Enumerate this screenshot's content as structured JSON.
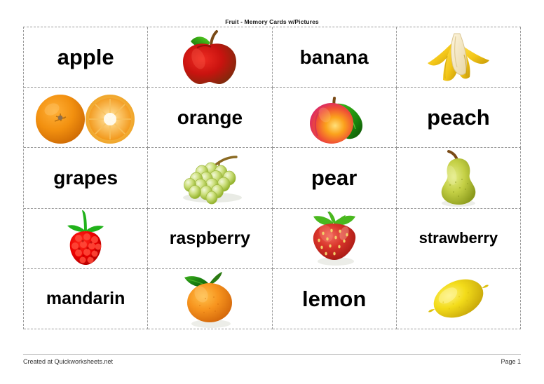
{
  "worksheet": {
    "title": "Fruit - Memory Cards w/Pictures"
  },
  "footer": {
    "credit": "Created at Quickworksheets.net",
    "page_label": "Page 1"
  },
  "colors": {
    "grid_border": "#9a9a9a",
    "text": "#000000",
    "footer_text": "#333333",
    "apple_red": "#cc1111",
    "banana_yellow": "#f2c81e",
    "orange": "#f08c12",
    "peach_pink": "#e8437f",
    "grape_green": "#b8d24a",
    "pear_green": "#b3bf3c",
    "raspberry_red": "#e60000",
    "strawberry_red": "#d42a22",
    "mandarin_orange": "#f58220",
    "lemon_yellow": "#ead310",
    "leaf_green": "#2e8b16"
  },
  "cards": [
    {
      "kind": "word",
      "label": "apple",
      "size": "len-short"
    },
    {
      "kind": "picture",
      "icon": "apple-icon",
      "label": "apple"
    },
    {
      "kind": "word",
      "label": "banana",
      "size": "len-med"
    },
    {
      "kind": "picture",
      "icon": "banana-icon",
      "label": "banana"
    },
    {
      "kind": "picture",
      "icon": "orange-icon",
      "label": "orange"
    },
    {
      "kind": "word",
      "label": "orange",
      "size": "len-med"
    },
    {
      "kind": "picture",
      "icon": "peach-icon",
      "label": "peach"
    },
    {
      "kind": "word",
      "label": "peach",
      "size": "len-short"
    },
    {
      "kind": "word",
      "label": "grapes",
      "size": "len-med"
    },
    {
      "kind": "picture",
      "icon": "grapes-icon",
      "label": "grapes"
    },
    {
      "kind": "word",
      "label": "pear",
      "size": "len-short"
    },
    {
      "kind": "picture",
      "icon": "pear-icon",
      "label": "pear"
    },
    {
      "kind": "picture",
      "icon": "raspberry-icon",
      "label": "raspberry"
    },
    {
      "kind": "word",
      "label": "raspberry",
      "size": "len-long"
    },
    {
      "kind": "picture",
      "icon": "strawberry-icon",
      "label": "strawberry"
    },
    {
      "kind": "word",
      "label": "strawberry",
      "size": "len-xlong"
    },
    {
      "kind": "word",
      "label": "mandarin",
      "size": "len-long"
    },
    {
      "kind": "picture",
      "icon": "mandarin-icon",
      "label": "mandarin"
    },
    {
      "kind": "word",
      "label": "lemon",
      "size": "len-short"
    },
    {
      "kind": "picture",
      "icon": "lemon-icon",
      "label": "lemon"
    }
  ]
}
